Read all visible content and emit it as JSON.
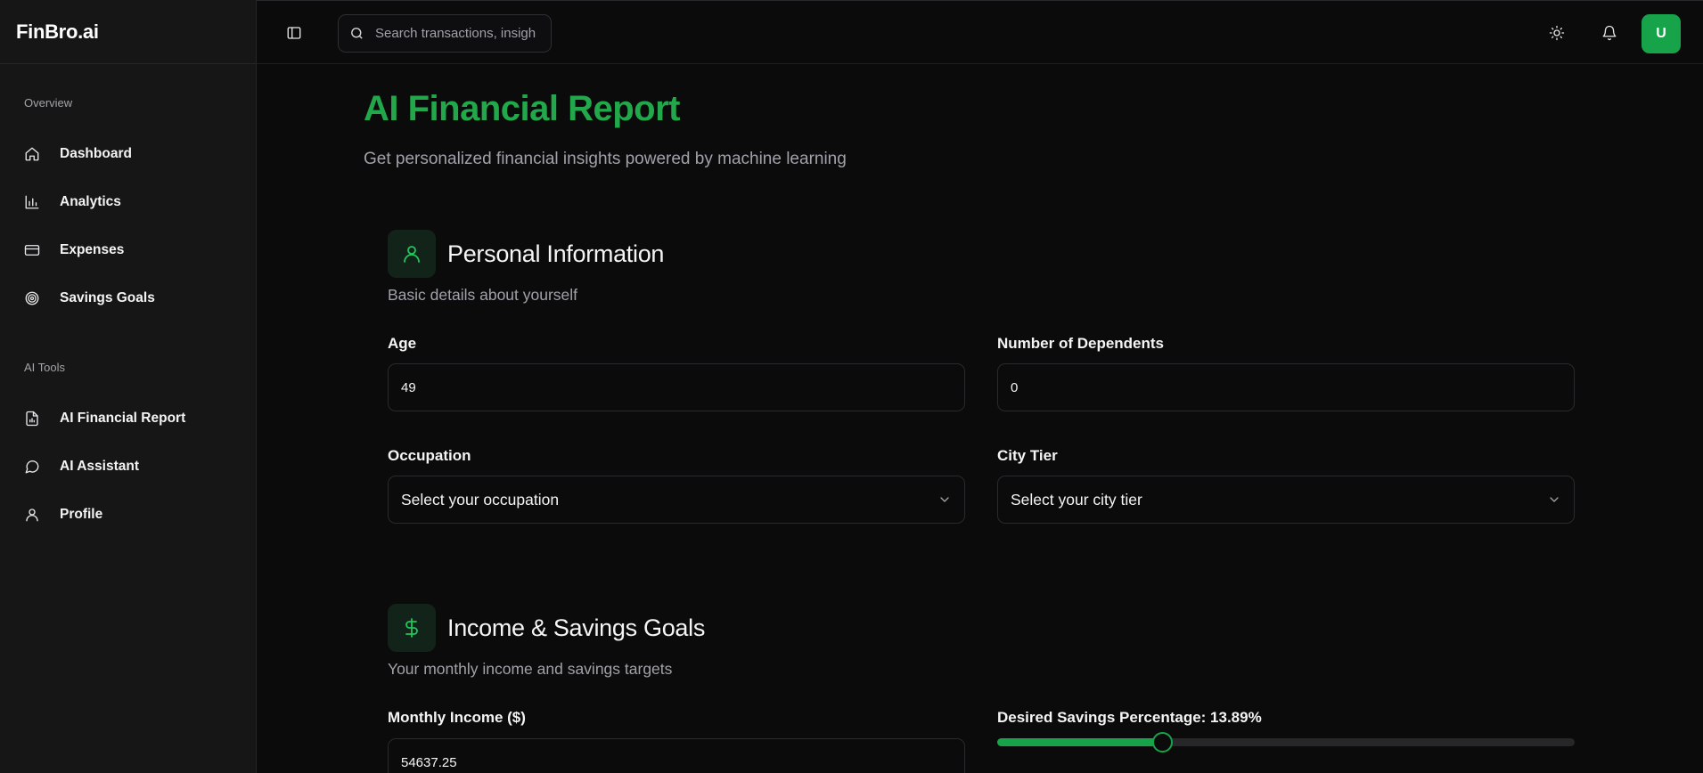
{
  "brand": {
    "name": "FinBro.ai"
  },
  "sidebar": {
    "sections": [
      {
        "label": "Overview",
        "items": [
          {
            "label": "Dashboard",
            "icon": "home-icon"
          },
          {
            "label": "Analytics",
            "icon": "bar-chart-icon"
          },
          {
            "label": "Expenses",
            "icon": "credit-card-icon"
          },
          {
            "label": "Savings Goals",
            "icon": "target-icon"
          }
        ]
      },
      {
        "label": "AI Tools",
        "items": [
          {
            "label": "AI Financial Report",
            "icon": "file-chart-icon"
          },
          {
            "label": "AI Assistant",
            "icon": "message-circle-icon"
          },
          {
            "label": "Profile",
            "icon": "user-icon"
          }
        ]
      }
    ]
  },
  "topbar": {
    "search_placeholder": "Search transactions, insights",
    "avatar_initial": "U",
    "icons": [
      "sidebar-toggle-icon",
      "search-icon",
      "sun-icon",
      "bell-icon"
    ]
  },
  "page": {
    "title": "AI Financial Report",
    "subtitle": "Get personalized financial insights powered by machine learning"
  },
  "personal_info": {
    "title": "Personal Information",
    "description": "Basic details about yourself",
    "icon": "user-icon",
    "age_label": "Age",
    "age_value": "49",
    "dependents_label": "Number of Dependents",
    "dependents_value": "0",
    "occupation_label": "Occupation",
    "occupation_value": "Select your occupation",
    "city_tier_label": "City Tier",
    "city_tier_value": "Select your city tier"
  },
  "income_savings": {
    "title": "Income & Savings Goals",
    "description": "Your monthly income and savings targets",
    "icon": "dollar-sign-icon",
    "income_label": "Monthly Income ($)",
    "income_value": "54637.25",
    "savings_label": "Desired Savings Percentage: 13.89%",
    "savings_percent": 13.89,
    "slider_fraction": 0.286
  },
  "colors": {
    "accent": "#16a34a",
    "title_green": "#22a84a",
    "background": "#0b0b0c",
    "sidebar_bg": "#161617"
  }
}
